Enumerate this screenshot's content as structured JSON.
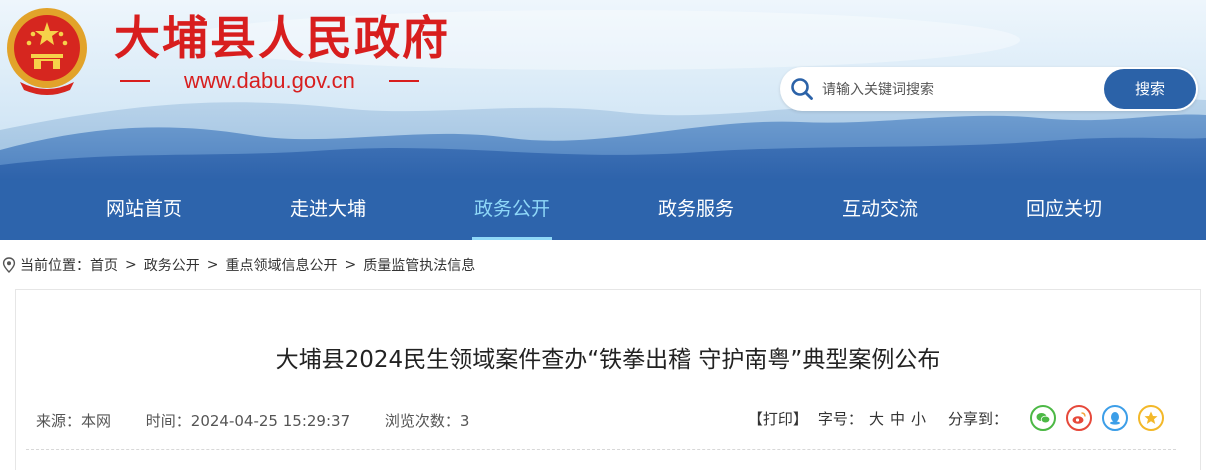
{
  "header": {
    "site_title": "大埔县人民政府",
    "site_url": "www.dabu.gov.cn",
    "emblem_icon": "national-emblem-icon"
  },
  "search": {
    "placeholder": "请输入关键词搜索",
    "button_label": "搜索"
  },
  "nav": {
    "items": [
      {
        "label": "网站首页"
      },
      {
        "label": "走进大埔"
      },
      {
        "label": "政务公开"
      },
      {
        "label": "政务服务"
      },
      {
        "label": "互动交流"
      },
      {
        "label": "回应关切"
      }
    ],
    "active_label": "政务公开"
  },
  "breadcrumb": {
    "prefix": "当前位置：",
    "items": [
      "首页",
      "政务公开",
      "重点领域信息公开",
      "质量监管执法信息"
    ],
    "separator": ">"
  },
  "article": {
    "title": "大埔县2024民生领域案件查办“铁拳出稽 守护南粤”典型案例公布",
    "source": "来源：本网",
    "time": "时间：2024-04-25 15:29:37",
    "views": "浏览次数：3",
    "print_label": "【打印】",
    "font_size_label": "字号：",
    "font_sizes": [
      "大",
      "中",
      "小"
    ],
    "share_label": "分享到："
  },
  "colors": {
    "brand_red": "#d81e1e",
    "nav_blue": "#2d64ac",
    "active_cyan": "#8fd8f8",
    "wechat_green": "#4cb845",
    "weibo_red": "#e6483a",
    "qq_blue": "#3c9ee8",
    "qzone_yellow": "#f3b829"
  }
}
